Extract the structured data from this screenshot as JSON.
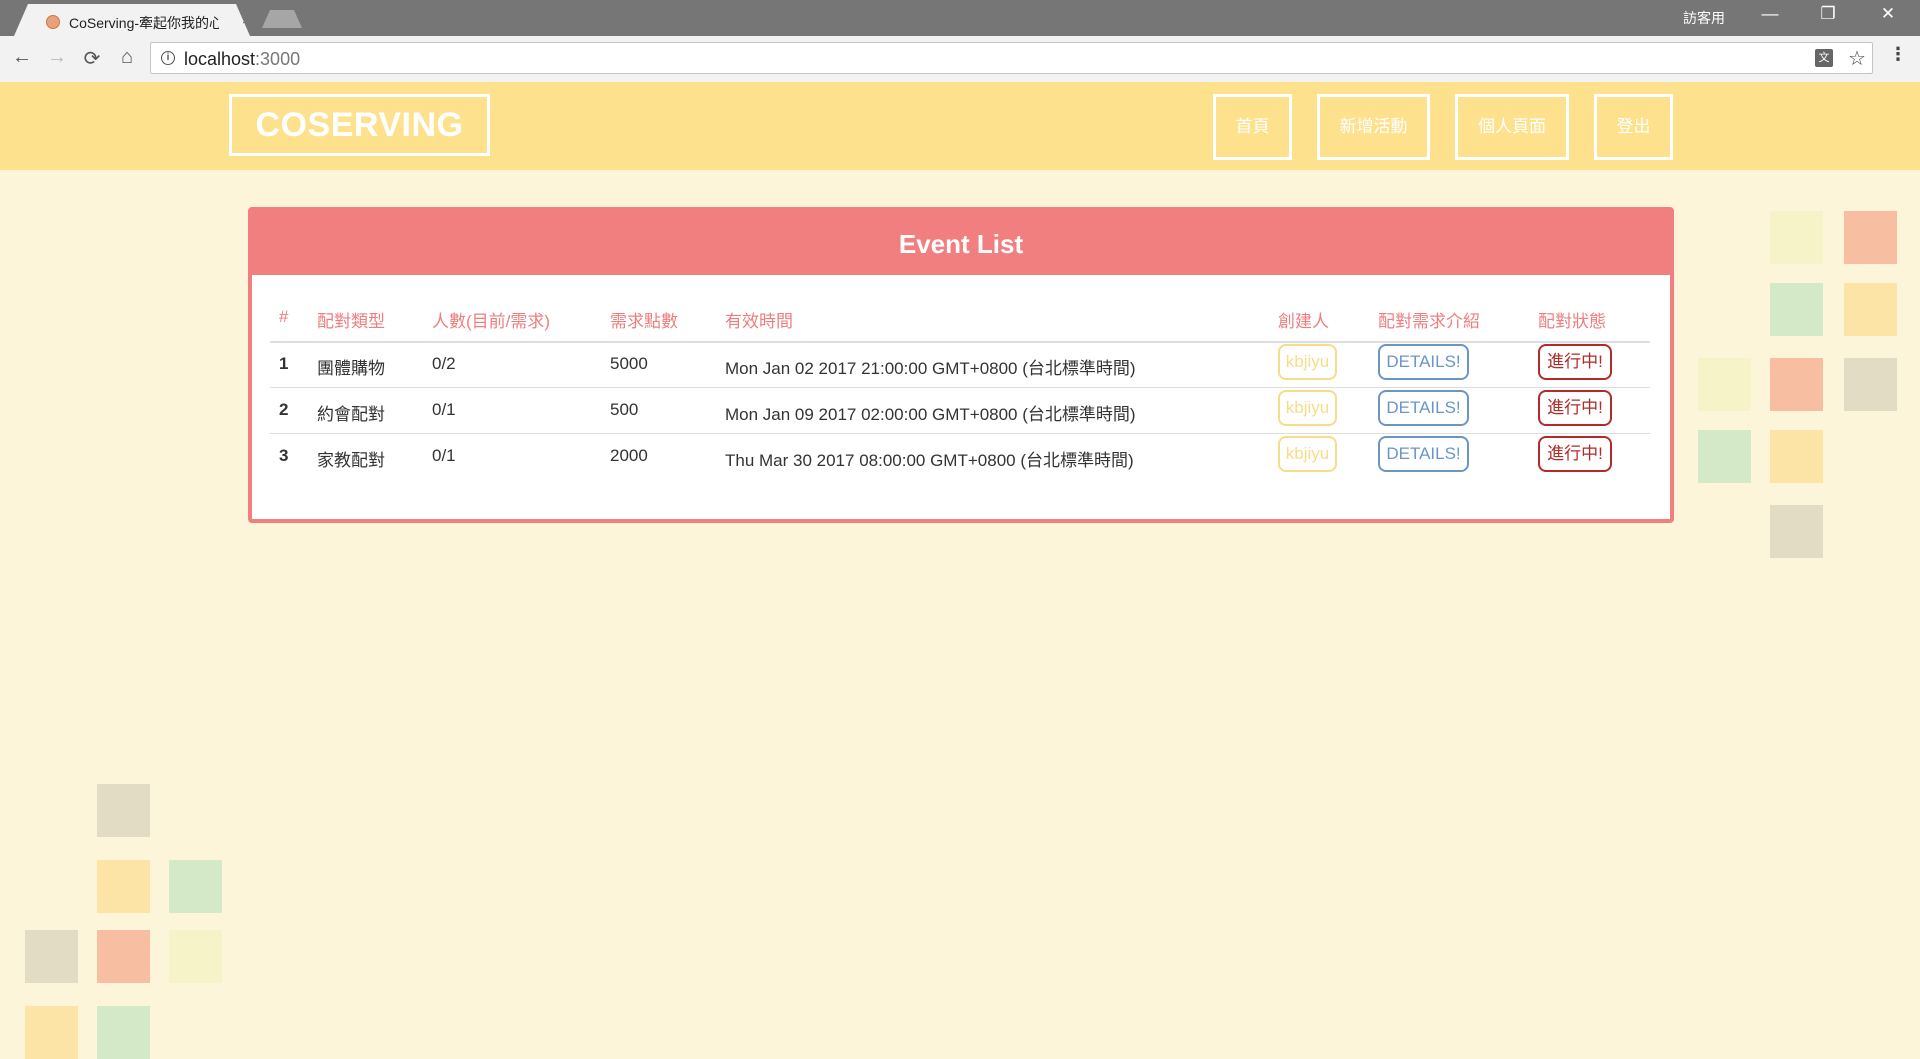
{
  "browser": {
    "tab_title": "CoServing-牽起你我的心",
    "tab_close": "×",
    "profile": "訪客用",
    "url_host": "localhost",
    "url_port": ":3000",
    "win_minimize": "—",
    "win_restore": "❐",
    "win_close": "✕",
    "back": "←",
    "forward": "→",
    "reload": "⟳",
    "home": "⌂",
    "info": "i",
    "translate": "文",
    "star": "☆",
    "menu": "⋮"
  },
  "header": {
    "logo": "COSERVING",
    "nav": [
      "首頁",
      "新增活動",
      "個人頁面",
      "登出"
    ]
  },
  "panel": {
    "title": "Event List",
    "columns": [
      "#",
      "配對類型",
      "人數(目前/需求)",
      "需求點數",
      "有效時間",
      "創建人",
      "配對需求介紹",
      "配對狀態"
    ],
    "rows": [
      {
        "num": "1",
        "type": "團體購物",
        "people": "0/2",
        "points": "5000",
        "time": "Mon Jan 02 2017 21:00:00 GMT+0800 (台北標準時間)",
        "creator": "kbjiyu",
        "details": "DETAILS!",
        "status": "進行中!"
      },
      {
        "num": "2",
        "type": "約會配對",
        "people": "0/1",
        "points": "500",
        "time": "Mon Jan 09 2017 02:00:00 GMT+0800 (台北標準時間)",
        "creator": "kbjiyu",
        "details": "DETAILS!",
        "status": "進行中!"
      },
      {
        "num": "3",
        "type": "家教配對",
        "people": "0/1",
        "points": "2000",
        "time": "Thu Mar 30 2017 08:00:00 GMT+0800 (台北標準時間)",
        "creator": "kbjiyu",
        "details": "DETAILS!",
        "status": "進行中!"
      }
    ]
  },
  "colors": {
    "page_bg": "#fdf5da",
    "header_bg": "#fde18d",
    "accent": "#f27f7f",
    "creator": "#f7dc8a",
    "details": "#6b95c9",
    "status": "#b22a2a"
  }
}
